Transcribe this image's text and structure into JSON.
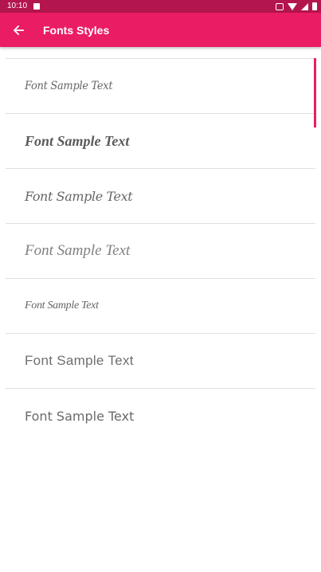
{
  "status_bar": {
    "time": "10:10",
    "icons": [
      "notification-icon",
      "vibrate-icon",
      "wifi-icon",
      "signal-icon",
      "battery-icon"
    ]
  },
  "app_bar": {
    "title": "Fonts Styles",
    "back_icon": "arrow-left-icon",
    "background": "#ea1c64",
    "status_background": "#b3154f"
  },
  "font_list": {
    "items": [
      {
        "label": "Font Sample Text"
      },
      {
        "label": "Font Sample Text"
      },
      {
        "label": "Font Sample Text"
      },
      {
        "label": "Font Sample Text"
      },
      {
        "label": "Font Sample Text"
      },
      {
        "label": "Font Sample Text"
      },
      {
        "label": "Font Sample Text"
      }
    ]
  }
}
